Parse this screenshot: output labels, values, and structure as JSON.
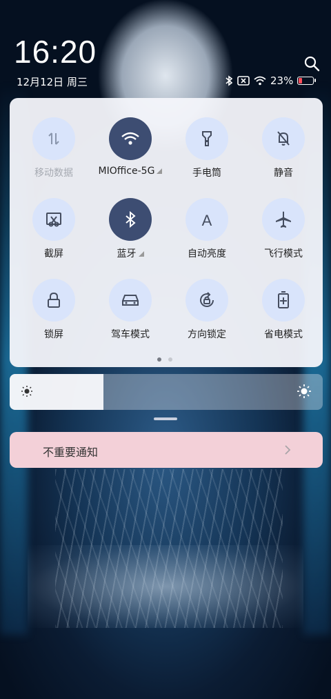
{
  "status": {
    "time": "16:20",
    "date": "12月12日 周三",
    "battery_percent": "23%",
    "battery_level": 0.23,
    "icons": [
      "bluetooth-icon",
      "sim-off-icon",
      "wifi-icon"
    ]
  },
  "toggles": [
    {
      "label": "移动数据",
      "icon": "mobile-data-icon",
      "active": false,
      "dim": true,
      "has_menu": false
    },
    {
      "label": "MIOffice-5G",
      "icon": "wifi-icon",
      "active": true,
      "dim": false,
      "has_menu": true
    },
    {
      "label": "手电筒",
      "icon": "flashlight-icon",
      "active": false,
      "dim": false,
      "has_menu": false
    },
    {
      "label": "静音",
      "icon": "silent-bell-icon",
      "active": false,
      "dim": false,
      "has_menu": false
    },
    {
      "label": "截屏",
      "icon": "screenshot-icon",
      "active": false,
      "dim": false,
      "has_menu": false
    },
    {
      "label": "蓝牙",
      "icon": "bluetooth-icon",
      "active": true,
      "dim": false,
      "has_menu": true
    },
    {
      "label": "自动亮度",
      "icon": "auto-brightness-icon",
      "active": false,
      "dim": false,
      "has_menu": false
    },
    {
      "label": "飞行模式",
      "icon": "airplane-icon",
      "active": false,
      "dim": false,
      "has_menu": false
    },
    {
      "label": "锁屏",
      "icon": "lock-icon",
      "active": false,
      "dim": false,
      "has_menu": false
    },
    {
      "label": "驾车模式",
      "icon": "car-icon",
      "active": false,
      "dim": false,
      "has_menu": false
    },
    {
      "label": "方向锁定",
      "icon": "rotation-lock-icon",
      "active": false,
      "dim": false,
      "has_menu": false
    },
    {
      "label": "省电模式",
      "icon": "battery-saver-icon",
      "active": false,
      "dim": false,
      "has_menu": false
    }
  ],
  "page_indicator": {
    "count": 2,
    "current": 1
  },
  "brightness": {
    "level": 0.3
  },
  "notification": {
    "label": "不重要通知"
  },
  "colors": {
    "active": "#3d4d72",
    "inactive": "#d9e4fb",
    "battery_low": "#ff4d5a",
    "notification_bg": "#f3d0d8"
  }
}
